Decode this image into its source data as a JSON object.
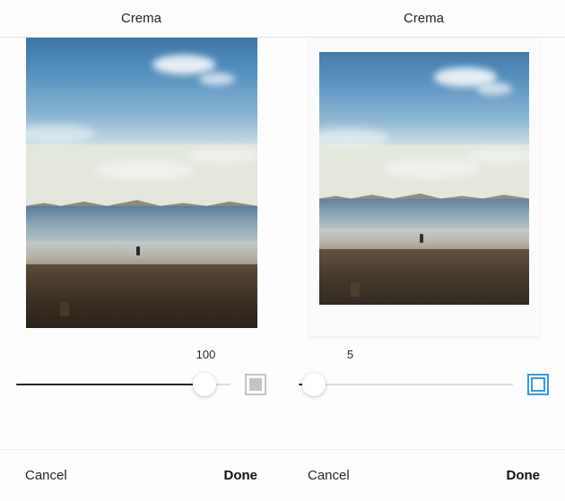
{
  "panes": [
    {
      "title": "Crema",
      "slider_value": "100",
      "slider_percent": 100,
      "frame_active": false,
      "cancel_label": "Cancel",
      "done_label": "Done"
    },
    {
      "title": "Crema",
      "slider_value": "5",
      "slider_percent": 5,
      "frame_active": true,
      "cancel_label": "Cancel",
      "done_label": "Done"
    }
  ]
}
